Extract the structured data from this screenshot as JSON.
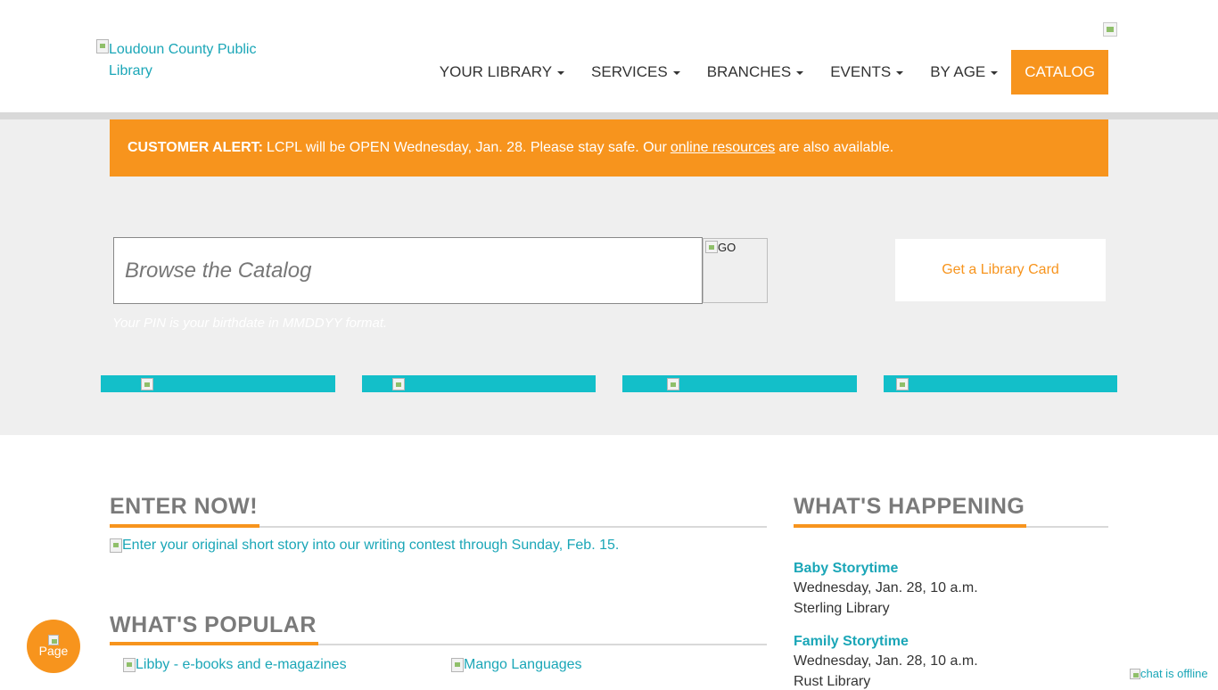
{
  "header": {
    "logo_alt": "Loudoun County Public Library",
    "nav": [
      {
        "label": "YOUR LIBRARY"
      },
      {
        "label": "SERVICES"
      },
      {
        "label": "BRANCHES"
      },
      {
        "label": "EVENTS"
      },
      {
        "label": "BY AGE"
      }
    ],
    "catalog_label": "CATALOG"
  },
  "alert": {
    "prefix": "CUSTOMER ALERT:",
    "text": "LCPL will be OPEN Wednesday, Jan. 28. Please stay safe. Our",
    "link": "online resources",
    "suffix": "are also available."
  },
  "search": {
    "placeholder": "Browse the Catalog",
    "go_label": "GO",
    "pin_hint": "Your PIN is your birthdate in MMDDYY format.",
    "card_label": "Get a Library Card"
  },
  "sections": {
    "enter_now": "ENTER NOW!",
    "contest_text": "Enter your original short story into our writing contest through Sunday, Feb. 15.",
    "whats_popular": "WHAT'S POPULAR",
    "popular_items": [
      {
        "label": "Libby - e-books and e-magazines"
      },
      {
        "label": "Mango Languages"
      }
    ],
    "whats_happening": "WHAT'S HAPPENING"
  },
  "events": [
    {
      "title": "Baby Storytime",
      "when": "Wednesday, Jan. 28, 10 a.m.",
      "where": "Sterling Library"
    },
    {
      "title": "Family Storytime",
      "when": "Wednesday, Jan. 28, 10 a.m.",
      "where": "Rust Library"
    }
  ],
  "widgets": {
    "page_bubble": "Page",
    "chat_status": "chat is offline"
  },
  "colors": {
    "accent": "#f7941d",
    "teal": "#13bfc9",
    "link": "#1aa6b7",
    "hero_bg": "#efefef"
  }
}
